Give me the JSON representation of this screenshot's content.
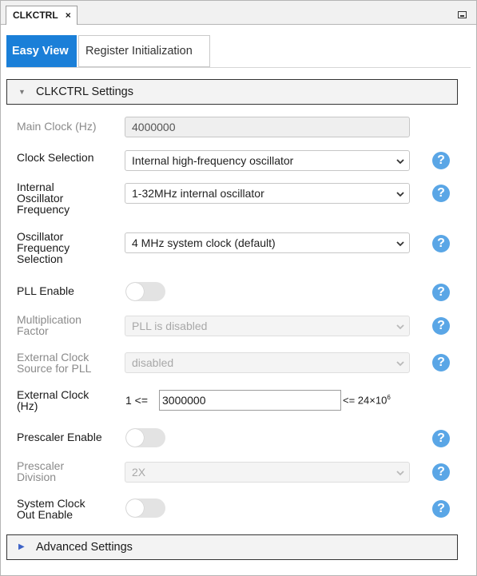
{
  "tab": {
    "title": "CLKCTRL",
    "close": "×"
  },
  "view_tabs": [
    "Easy View",
    "Register Initialization"
  ],
  "sections": {
    "clkctrl": "CLKCTRL Settings",
    "advanced": "Advanced Settings"
  },
  "rows": {
    "main_clock": {
      "label": "Main Clock (Hz)",
      "value": "4000000"
    },
    "clock_selection": {
      "label": "Clock Selection",
      "value": "Internal high-frequency oscillator"
    },
    "int_osc_freq": {
      "label_lines": [
        "Internal",
        "Oscillator",
        "Frequency"
      ],
      "value": "1-32MHz internal oscillator"
    },
    "osc_freq_sel": {
      "label_lines": [
        "Oscillator",
        "Frequency",
        "Selection"
      ],
      "value": "4 MHz system clock (default)"
    },
    "pll_enable": {
      "label": "PLL Enable",
      "state": "off"
    },
    "mult_factor": {
      "label_lines": [
        "Multiplication",
        "Factor"
      ],
      "value": "PLL is disabled"
    },
    "ext_clk_src_pll": {
      "label_lines": [
        "External Clock",
        "Source for PLL"
      ],
      "value": "disabled"
    },
    "ext_clock": {
      "label_lines": [
        "External Clock",
        "(Hz)"
      ],
      "min": "1 <=",
      "value": "3000000",
      "max_prefix": "<= 24×10",
      "max_exp": "6"
    },
    "prescaler_enable": {
      "label": "Prescaler Enable",
      "state": "off"
    },
    "prescaler_div": {
      "label_lines": [
        "Prescaler",
        "Division"
      ],
      "value": "2X"
    },
    "sys_clk_out": {
      "label_lines": [
        "System Clock",
        "Out Enable"
      ],
      "state": "off"
    }
  },
  "help_symbol": "?",
  "colors": {
    "accent": "#1a7fd8",
    "help": "#5aa6e6",
    "toggle_off": "#e3e3e3"
  }
}
